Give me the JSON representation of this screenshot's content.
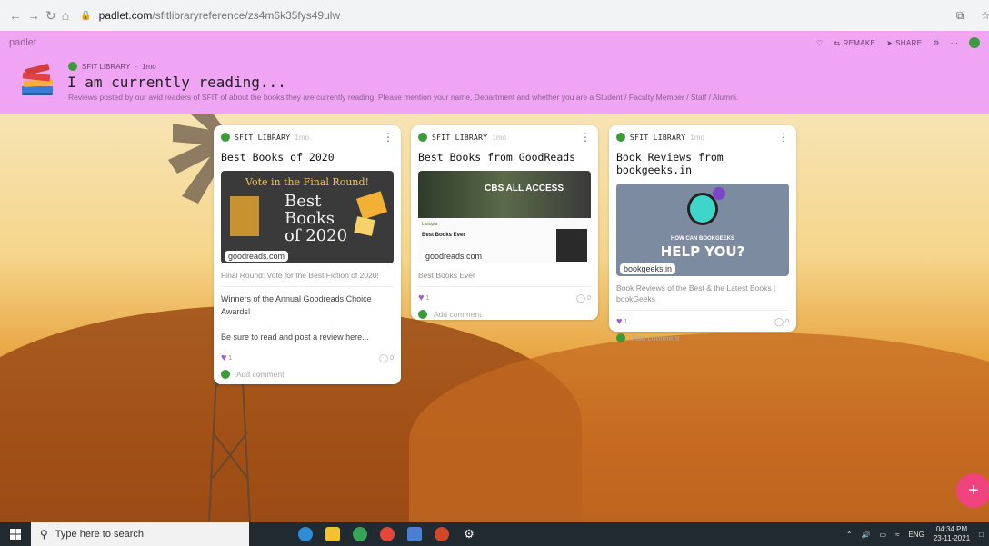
{
  "browser": {
    "url_domain": "padlet.com",
    "url_path": "/sfitlibraryreference/zs4m6k35fys49ulw"
  },
  "header": {
    "logo": "padlet",
    "actions": {
      "remake": "REMAKE",
      "share": "SHARE"
    },
    "author": "SFIT LIBRARY",
    "time": "1mo",
    "title": "I am currently reading...",
    "description": "Reviews posted by our avid readers of SFIT of about the books they are currently reading. Please mention your name, Department and whether you are a Student / Faculty Member / Staff / Alumni."
  },
  "cards": [
    {
      "author": "SFIT LIBRARY",
      "time": "1mo",
      "title": "Best Books of 2020",
      "link": "goodreads.com",
      "preview_banner": "Vote in the Final Round!",
      "preview_big1": "Best",
      "preview_big2": "Books",
      "preview_big3": "of 2020",
      "subtitle": "Final Round: Vote for the Best Fiction of 2020!",
      "body1": "Winners of the Annual Goodreads Choice Awards!",
      "body2": "Be sure to read and post a review here...",
      "likes": "1",
      "comments": "0",
      "add_comment": "Add comment"
    },
    {
      "author": "SFIT LIBRARY",
      "time": "1mo",
      "title": "Best Books from GoodReads",
      "link": "goodreads.com",
      "preview_brand": "CBS ALL ACCESS",
      "preview_list": "Listopia",
      "preview_heading": "Best Books Ever",
      "subtitle": "Best Books Ever",
      "likes": "1",
      "comments": "0",
      "add_comment": "Add comment"
    },
    {
      "author": "SFIT LIBRARY",
      "time": "1mo",
      "title": "Book Reviews from bookgeeks.in",
      "link": "bookgeeks.in",
      "preview_small": "HOW CAN BOOKGEEKS",
      "preview_big": "HELP YOU?",
      "subtitle": "Book Reviews of the Best & the Latest Books | bookGeeks",
      "likes": "1",
      "comments": "0",
      "add_comment": "Add comment"
    }
  ],
  "taskbar": {
    "search_placeholder": "Type here to search",
    "lang": "ENG",
    "time": "04:34 PM",
    "date": "23-11-2021"
  },
  "colors": {
    "header_bg": "#f0a5f4",
    "accent_pink": "#f0437d",
    "like_purple": "#a55dcc",
    "avatar_green": "#3b9b3b"
  }
}
